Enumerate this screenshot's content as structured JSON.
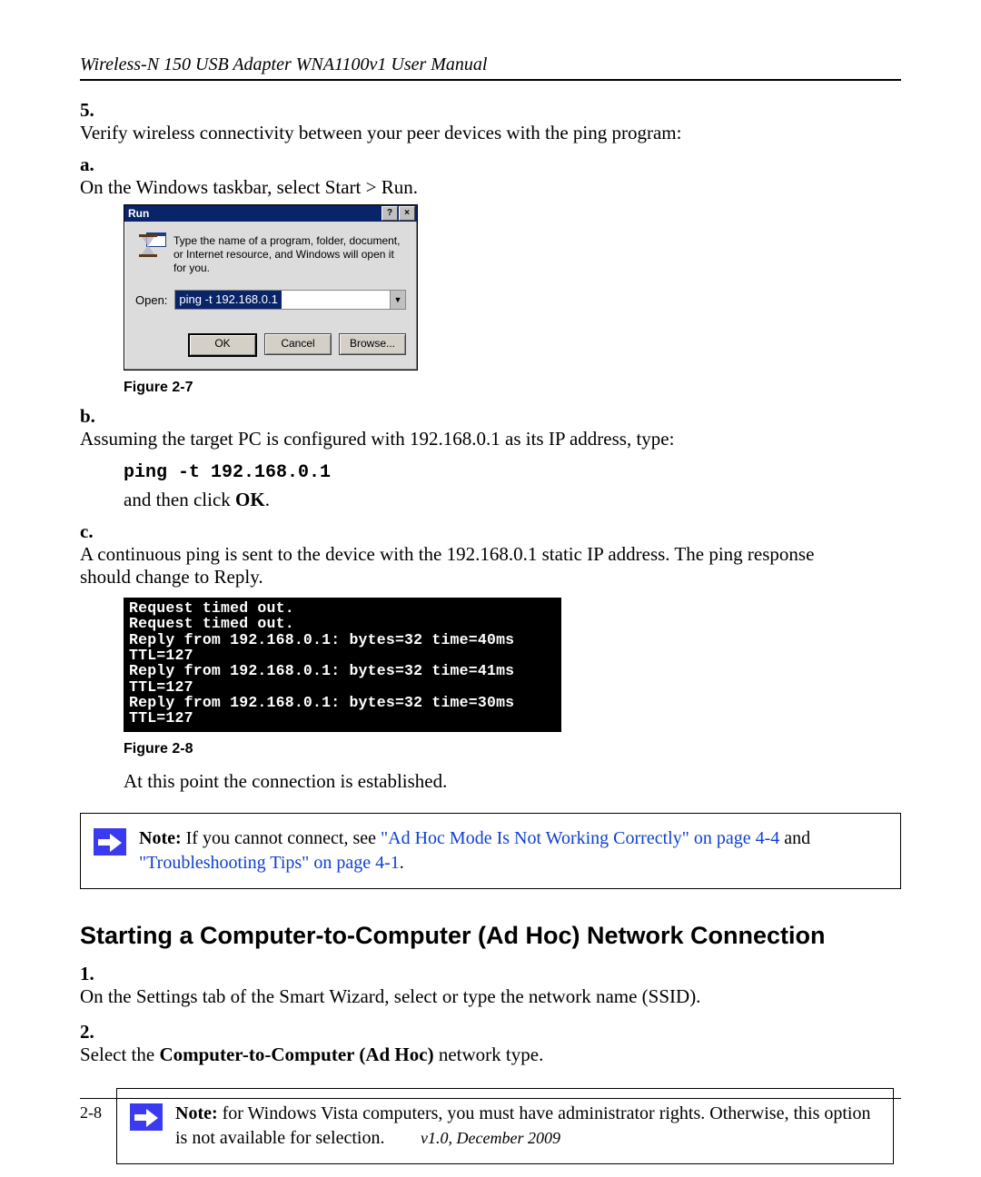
{
  "header": {
    "title": "Wireless-N 150 USB Adapter WNA1100v1 User Manual"
  },
  "step5": {
    "num": "5.",
    "text": "Verify wireless connectivity between your peer devices with the ping program:",
    "a": {
      "alpha": "a.",
      "text": "On the Windows taskbar, select Start > Run."
    },
    "run_dialog": {
      "title": "Run",
      "help": "?",
      "close": "×",
      "desc": "Type the name of a program, folder, document, or Internet resource, and Windows will open it for you.",
      "open_label": "Open:",
      "open_value": "ping -t 192.168.0.1",
      "dd": "▼",
      "ok": "OK",
      "cancel": "Cancel",
      "browse": "Browse..."
    },
    "fig7": "Figure 2-7",
    "b": {
      "alpha": "b.",
      "text1": "Assuming the target PC is configured with 192.168.0.1 as its IP address, type:",
      "cmd": "ping -t 192.168.0.1",
      "text2a": "and then click ",
      "text2b": "OK",
      "text2c": "."
    },
    "c": {
      "alpha": "c.",
      "text": "A continuous ping is sent to the device with the 192.168.0.1 static IP address. The ping response should change to Reply."
    },
    "console": {
      "l1": "Request timed out.",
      "l2": "Request timed out.",
      "l3": "Reply from 192.168.0.1: bytes=32 time=40ms TTL=127",
      "l4": "Reply from 192.168.0.1: bytes=32 time=41ms TTL=127",
      "l5": "Reply from 192.168.0.1: bytes=32 time=30ms TTL=127"
    },
    "fig8": "Figure 2-8",
    "after_fig8": "At this point the connection is established."
  },
  "note1": {
    "label": "Note: ",
    "t1": "If you cannot connect, see ",
    "link1": "\"Ad Hoc Mode Is Not Working Correctly\" on page 4-4",
    "t2": " and ",
    "link2": "\"Troubleshooting Tips\" on page 4-1",
    "t3": "."
  },
  "section2": {
    "heading": "Starting a Computer-to-Computer (Ad Hoc) Network Connection"
  },
  "step1b": {
    "num": "1.",
    "text": "On the Settings tab of the Smart Wizard, select or type the network name (SSID)."
  },
  "step2b": {
    "num": "2.",
    "t1": "Select the ",
    "bold": "Computer-to-Computer (Ad Hoc)",
    "t2": " network type."
  },
  "note2": {
    "label": "Note: ",
    "text": "for Windows Vista computers, you must have administrator rights. Otherwise, this option is not available for selection."
  },
  "footer": {
    "page": "2-8",
    "version": "v1.0, December 2009"
  }
}
